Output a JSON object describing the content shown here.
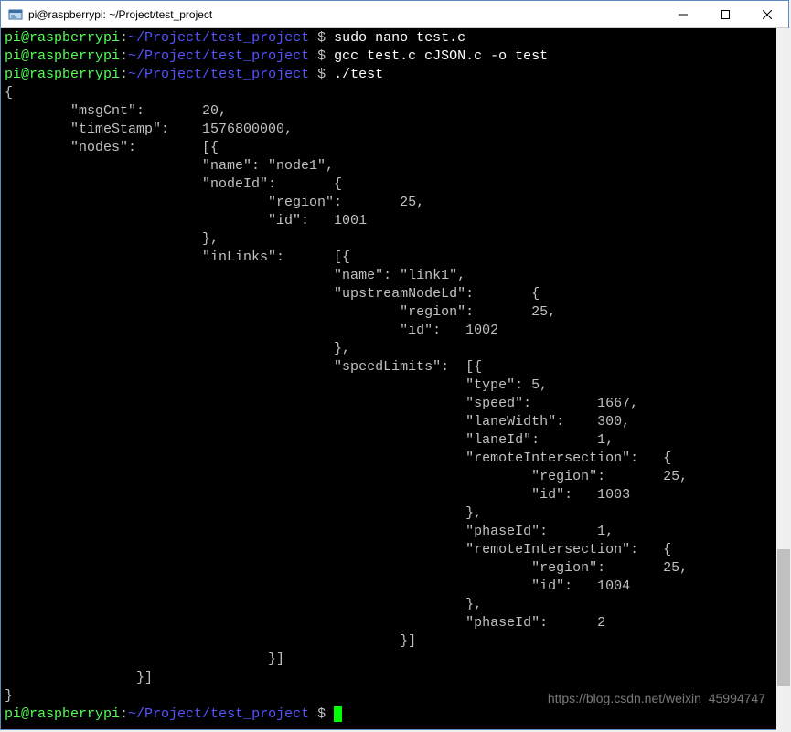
{
  "window": {
    "title": "pi@raspberrypi: ~/Project/test_project"
  },
  "prompt": {
    "user_host": "pi@raspberrypi",
    "colon": ":",
    "path": "~/Project/test_project",
    "dollar": " $ "
  },
  "commands": {
    "c1": "sudo nano test.c",
    "c2": "gcc test.c cJSON.c -o test",
    "c3": "./test"
  },
  "output_lines": [
    "{",
    "        \"msgCnt\":       20,",
    "        \"timeStamp\":    1576800000,",
    "        \"nodes\":        [{",
    "                        \"name\": \"node1\",",
    "                        \"nodeId\":       {",
    "                                \"region\":       25,",
    "                                \"id\":   1001",
    "                        },",
    "                        \"inLinks\":      [{",
    "                                        \"name\": \"link1\",",
    "                                        \"upstreamNodeLd\":       {",
    "                                                \"region\":       25,",
    "                                                \"id\":   1002",
    "                                        },",
    "                                        \"speedLimits\":  [{",
    "                                                        \"type\": 5,",
    "                                                        \"speed\":        1667,",
    "                                                        \"laneWidth\":    300,",
    "                                                        \"laneId\":       1,",
    "                                                        \"remoteIntersection\":   {",
    "                                                                \"region\":       25,",
    "                                                                \"id\":   1003",
    "                                                        },",
    "                                                        \"phaseId\":      1,",
    "                                                        \"remoteIntersection\":   {",
    "                                                                \"region\":       25,",
    "                                                                \"id\":   1004",
    "                                                        },",
    "                                                        \"phaseId\":      2",
    "                                                }]",
    "                                }]",
    "                }]",
    "}"
  ],
  "watermark": "https://blog.csdn.net/weixin_45994747"
}
